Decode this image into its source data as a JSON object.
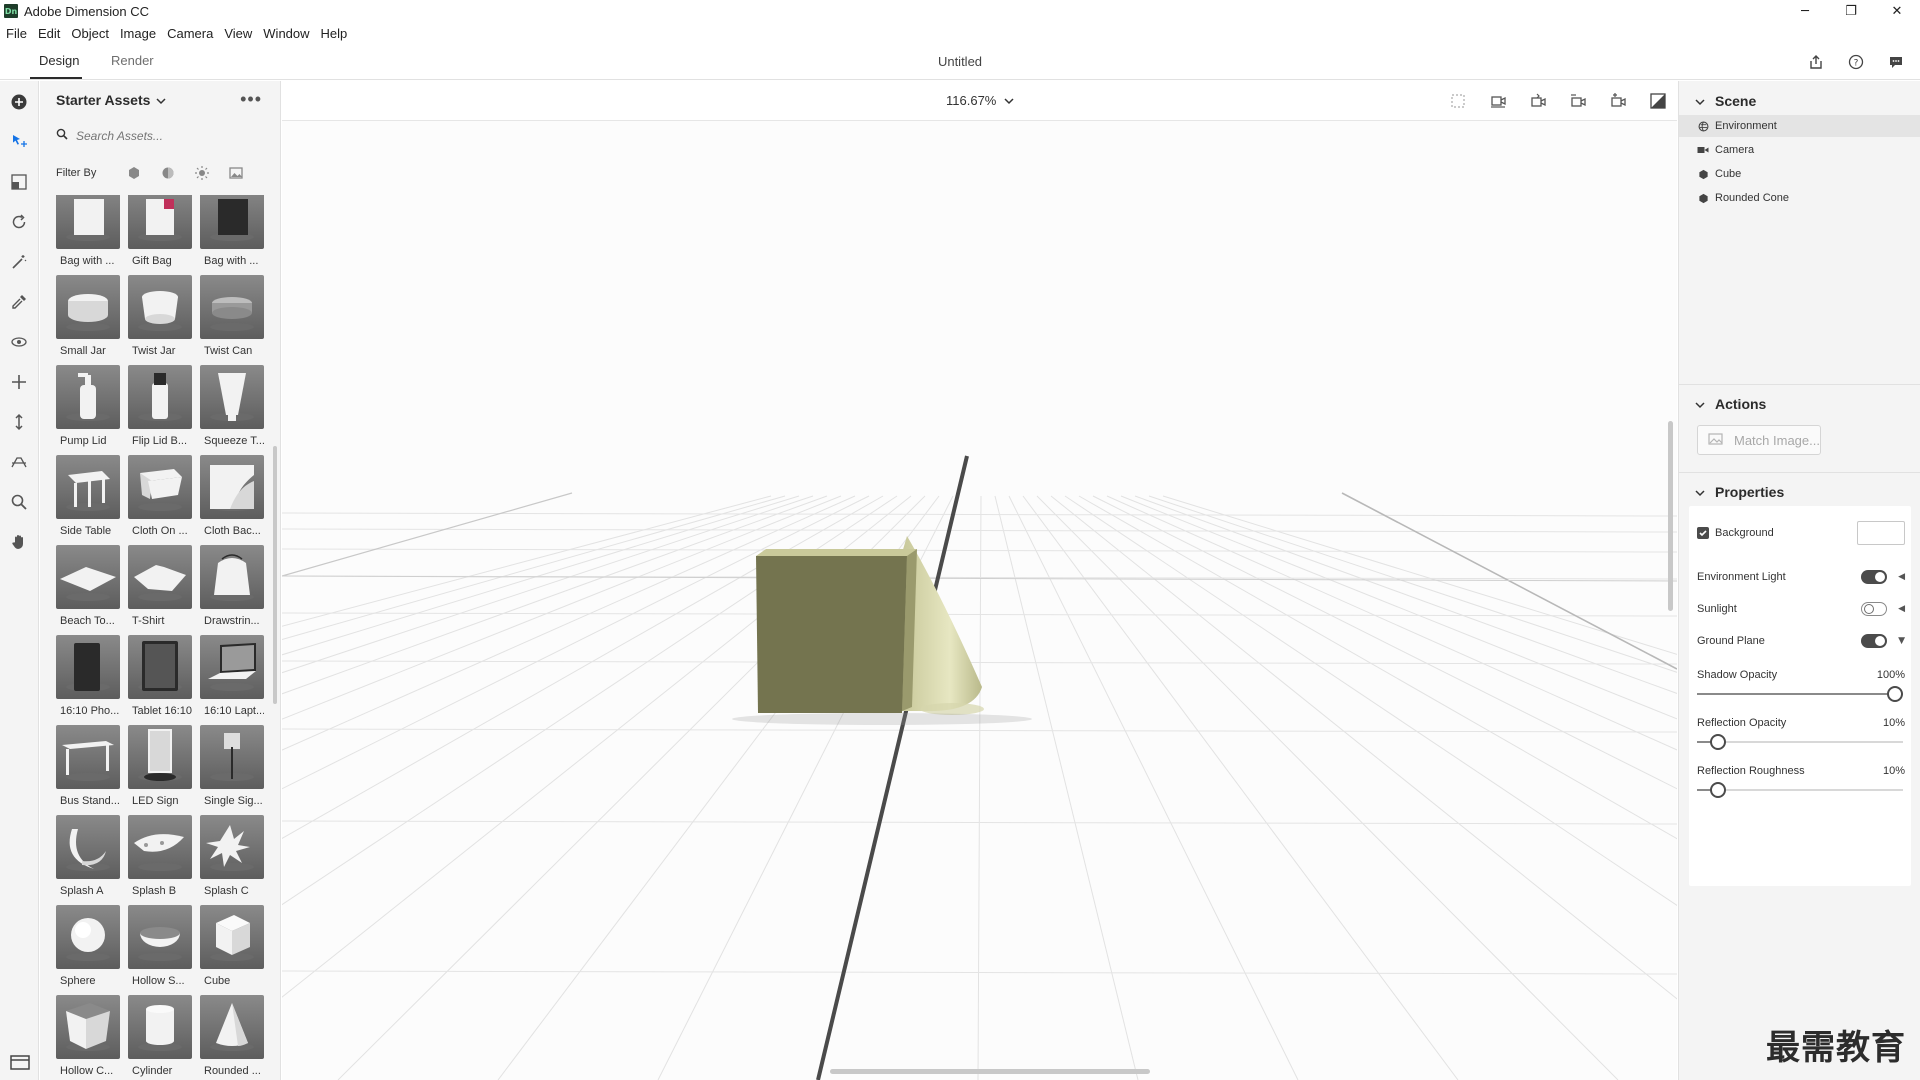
{
  "window": {
    "app_logo": "Dn",
    "title": "Adobe Dimension CC",
    "minimize": "─",
    "restore": "❐",
    "close": "✕"
  },
  "menu": [
    "File",
    "Edit",
    "Object",
    "Image",
    "Camera",
    "View",
    "Window",
    "Help"
  ],
  "workspace": {
    "tabs": [
      "Design",
      "Render"
    ],
    "active_tab": "Design",
    "document_title": "Untitled"
  },
  "assets": {
    "header": "Starter Assets",
    "search_placeholder": "Search Assets...",
    "filter_label": "Filter By",
    "items": [
      {
        "label": "Bag with ...",
        "shape": "bag-white"
      },
      {
        "label": "Gift Bag",
        "shape": "gift-bag"
      },
      {
        "label": "Bag with ...",
        "shape": "bag-black"
      },
      {
        "label": "Small Jar",
        "shape": "small-jar"
      },
      {
        "label": "Twist Jar",
        "shape": "twist-jar"
      },
      {
        "label": "Twist Can",
        "shape": "twist-can"
      },
      {
        "label": "Pump Lid",
        "shape": "pump-lid"
      },
      {
        "label": "Flip Lid B...",
        "shape": "flip-lid"
      },
      {
        "label": "Squeeze T...",
        "shape": "squeeze-tube"
      },
      {
        "label": "Side Table",
        "shape": "side-table"
      },
      {
        "label": "Cloth On ...",
        "shape": "cloth-table"
      },
      {
        "label": "Cloth Bac...",
        "shape": "cloth-back"
      },
      {
        "label": "Beach To...",
        "shape": "beach-towel"
      },
      {
        "label": "T-Shirt",
        "shape": "tshirt"
      },
      {
        "label": "Drawstrin...",
        "shape": "drawstring"
      },
      {
        "label": "16:10 Pho...",
        "shape": "phone"
      },
      {
        "label": "Tablet 16:10",
        "shape": "tablet"
      },
      {
        "label": "16:10 Lapt...",
        "shape": "laptop"
      },
      {
        "label": "Bus Stand...",
        "shape": "bus-stand"
      },
      {
        "label": "LED Sign",
        "shape": "led-sign"
      },
      {
        "label": "Single Sig...",
        "shape": "single-sign"
      },
      {
        "label": "Splash A",
        "shape": "splash-a"
      },
      {
        "label": "Splash B",
        "shape": "splash-b"
      },
      {
        "label": "Splash C",
        "shape": "splash-c"
      },
      {
        "label": "Sphere",
        "shape": "sphere"
      },
      {
        "label": "Hollow S...",
        "shape": "hollow-sphere"
      },
      {
        "label": "Cube",
        "shape": "cube"
      },
      {
        "label": "Hollow C...",
        "shape": "hollow-cube"
      },
      {
        "label": "Cylinder",
        "shape": "cylinder"
      },
      {
        "label": "Rounded ...",
        "shape": "cone"
      }
    ]
  },
  "canvas": {
    "zoom": "116.67%",
    "object_colors": {
      "cube_front": "#74744f",
      "cube_top": "#c9c99a",
      "cube_side": "#9a9a6d",
      "cone_light": "#e7e7c2",
      "cone_mid": "#c8c89a"
    }
  },
  "scene": {
    "title": "Scene",
    "items": [
      {
        "label": "Environment",
        "icon": "globe-icon",
        "selected": true
      },
      {
        "label": "Camera",
        "icon": "camera-icon",
        "selected": false
      },
      {
        "label": "Cube",
        "icon": "cube-icon",
        "selected": false
      },
      {
        "label": "Rounded Cone",
        "icon": "cube-icon",
        "selected": false
      }
    ]
  },
  "actions": {
    "title": "Actions",
    "match_image": "Match Image..."
  },
  "properties": {
    "title": "Properties",
    "background": {
      "label": "Background",
      "checked": true,
      "color": "#ffffff"
    },
    "environment_light": {
      "label": "Environment Light",
      "on": true
    },
    "sunlight": {
      "label": "Sunlight",
      "on": false
    },
    "ground_plane": {
      "label": "Ground Plane",
      "on": true
    },
    "shadow_opacity": {
      "label": "Shadow Opacity",
      "value_text": "100%",
      "value": 100
    },
    "reflection_opacity": {
      "label": "Reflection Opacity",
      "value_text": "10%",
      "value": 10
    },
    "reflection_roughness": {
      "label": "Reflection Roughness",
      "value_text": "10%",
      "value": 10
    }
  },
  "watermark": "最需教育"
}
